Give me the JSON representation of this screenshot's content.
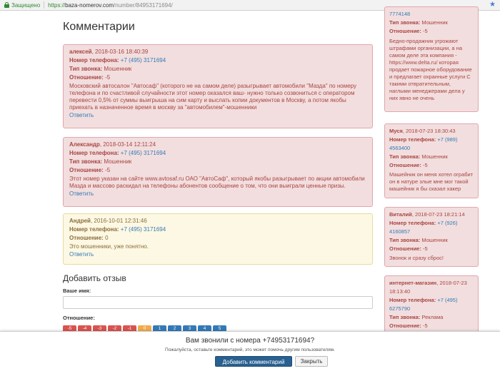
{
  "browser": {
    "secure_label": "Защищено",
    "url_scheme": "https://",
    "url_host": "baza-nomerov.com",
    "url_path": "/number/84953171694/"
  },
  "page": {
    "title": "Комментарии"
  },
  "labels": {
    "phone": "Номер телефона:",
    "call_type": "Тип звонка:",
    "attitude": "Отношение:",
    "reply": "Ответить"
  },
  "comments": [
    {
      "author": "алексей",
      "date": "2018-03-16 18:40:39",
      "phone": "+7 (495) 3171694",
      "call_type": "Мошенник",
      "attitude": "-5",
      "text": "Московский автосалон \"Автосаф\" (которого не на самом деле) разыгрывает автомобили \"Мазда\" по номеру телефона и по счастливой случайности этот номер оказался ваш- нужно только созвониться с оператором перевести 0,5% от суммы выигрыша на сим карту и выслать копии документов в Москву, а потом якобы приехать в назначенное время в москву за \"автомобилем\"-мошенники"
    },
    {
      "author": "Александр",
      "date": "2018-03-14 12:11:24",
      "phone": "+7 (495) 3171694",
      "call_type": "Мошенник",
      "attitude": "-5",
      "text": "Этот номер указан на сайте www.avtosaf.ru ОАО \"АвтоСаф\", который якобы разыгрывает по акции автомобили Мазда и массово раскидал на телефоны абонентов сообщение о том, что они выиграли ценные призы."
    },
    {
      "author": "Андрей",
      "date": "2016-10-01 12:31:46",
      "phone": "+7 (495) 3171694",
      "attitude": "0",
      "text": "Это мошенники, уже понятно."
    }
  ],
  "form": {
    "title": "Добавить отзыв",
    "name_label": "Ваше имя:",
    "attitude_label": "Отношение:",
    "ratings": [
      {
        "label": "-5",
        "color": "#d9534f"
      },
      {
        "label": "-4",
        "color": "#d9534f"
      },
      {
        "label": "-3",
        "color": "#d9534f"
      },
      {
        "label": "-2",
        "color": "#d9534f"
      },
      {
        "label": "-1",
        "color": "#d9534f"
      },
      {
        "label": "0",
        "color": "#f0ad4e"
      },
      {
        "label": "1",
        "color": "#337ab7"
      },
      {
        "label": "2",
        "color": "#337ab7"
      },
      {
        "label": "3",
        "color": "#337ab7"
      },
      {
        "label": "4",
        "color": "#337ab7"
      },
      {
        "label": "5",
        "color": "#337ab7"
      }
    ]
  },
  "sidebar": [
    {
      "phone_tail": "7774148",
      "call_type": "Мошенник",
      "attitude": "-5",
      "text": "Бедно-продажник угрожают штрафами организации, а на самом деле эта компания - https://www.delta.ru/ которая продает пожарное оборудование и предлагает охранные услуги С такими отвратительным, наглыми менеджерами дела у них явно не очень"
    },
    {
      "author": "Муся",
      "date": "2018-07-23 18:30:43",
      "phone_a": "+7 (989)",
      "phone_b": "4563400",
      "call_type": "Мошенник",
      "attitude": "-5",
      "text": "Машейник он меня хотел ограбит он в натуре злые мне мог такой машейник я бы сказал хакер"
    },
    {
      "author": "Виталий",
      "date": "2018-07-23 18:21:14",
      "phone_a": "+7 (926)",
      "phone_b": "4160857",
      "call_type": "Мошенник",
      "attitude": "-5",
      "text": "Звонок и сразу сброс!"
    },
    {
      "author": "интернет-магазин",
      "date_a": "2018-07-23",
      "date_b": "18:13:40",
      "phone_a": "+7 (495)",
      "phone_b": "6275790",
      "call_type": "Реклама",
      "attitude": "-5"
    }
  ],
  "popup": {
    "title": "Вам звонили с номера +74953171694?",
    "subtitle": "Пожалуйста, оставьте комментарий, это может помочь другим пользователям.",
    "add_button": "Добавить комментарий",
    "close_button": "Закрыть"
  }
}
